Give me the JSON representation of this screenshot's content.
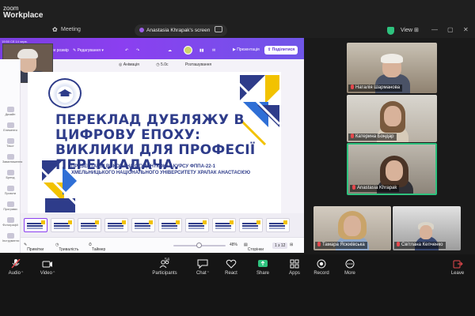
{
  "app": {
    "brand_line1": "zoom",
    "brand_line2": "Workplace",
    "meeting_label": "Meeting",
    "view_label": "View"
  },
  "share": {
    "label": "Anastasia Khrapak's screen",
    "accent": "#9b5de5"
  },
  "canva": {
    "top_small": "19:50  Сб 14 черв.",
    "resize": "Змінити розмір",
    "edit": "Редагування",
    "present": "Презентація",
    "share": "Поділитися",
    "tools": [
      "Анімація",
      "5.0с",
      "Розташування"
    ],
    "rail": [
      "Дизайн",
      "Елементи",
      "Текст",
      "Завантаження",
      "Бренд",
      "Проєкти",
      "Програми",
      "Фотографії",
      "Інструменти"
    ],
    "slide": {
      "title": "ПЕРЕКЛАД ДУБЛЯЖУ В ЦИФРОВУ ЕПОХУ: ВИКЛИКИ ДЛЯ ПРОФЕСІЇ ПЕРЕКЛАДАЧА.",
      "subtitle": "ПРЕЗЕНТАЦІЯ ВИКОНАНА СТУДЕНТКОЮ 3 КУРСУ ФППА-22-1 ХМЕЛЬНИЦЬКОГО НАЦІОНАЛЬНОГО УНІВЕРСИТЕТУ ХРАПАК АНАСТАСІЄЮ",
      "colors": {
        "navy": "#2e3c8a",
        "yellow": "#f2c200",
        "blue": "#2f6fd6"
      }
    },
    "bottom": {
      "notes": "Примітки",
      "duration": "Тривалість",
      "timer": "Таймер",
      "zoom": "48%",
      "pages": "Сторінки",
      "pager": "1 з 12",
      "zoom_level": 0.48
    }
  },
  "participants": [
    {
      "name": "Наталія Шарманова"
    },
    {
      "name": "Катерина Бондар"
    },
    {
      "name": "Anastasia Khrapak"
    },
    {
      "name": "Тамара Ясюківська"
    },
    {
      "name": "Світлана Кепченко"
    }
  ],
  "controls": {
    "audio": "Audio",
    "video": "Video",
    "participants": "Participants",
    "participants_count": "54",
    "chat": "Chat",
    "react": "React",
    "share": "Share",
    "apps": "Apps",
    "record": "Record",
    "more": "More",
    "leave": "Leave"
  }
}
